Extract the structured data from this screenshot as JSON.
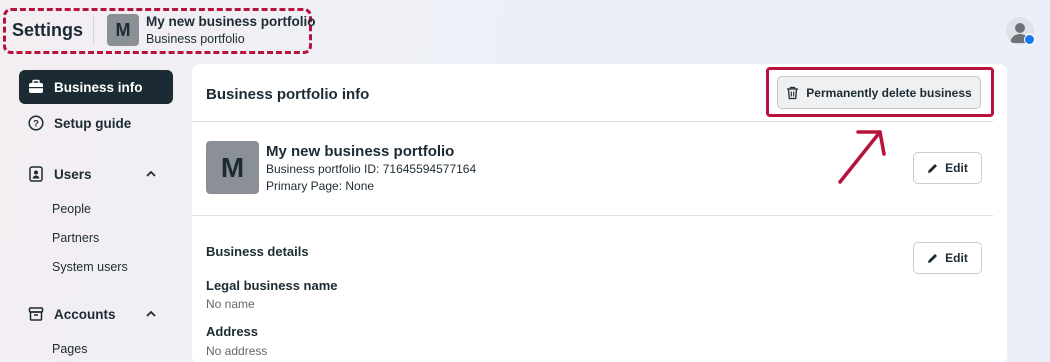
{
  "header": {
    "title": "Settings",
    "portfolio_initial": "M",
    "portfolio_name": "My new business portfolio",
    "portfolio_type": "Business portfolio"
  },
  "sidebar": {
    "items": [
      {
        "label": "Business info",
        "icon": "briefcase-icon",
        "active": true
      },
      {
        "label": "Setup guide",
        "icon": "help-circle-icon"
      },
      {
        "label": "Users",
        "icon": "user-badge-icon",
        "expanded": true,
        "children": [
          "People",
          "Partners",
          "System users"
        ]
      },
      {
        "label": "Accounts",
        "icon": "archive-icon",
        "expanded": true,
        "children": [
          "Pages"
        ]
      }
    ]
  },
  "main": {
    "title": "Business portfolio info",
    "delete_button": "Permanently delete business",
    "business": {
      "initial": "M",
      "name": "My new business portfolio",
      "id_line": "Business portfolio ID: 71645594577164",
      "primary_page_line": "Primary Page: None",
      "edit_label": "Edit"
    },
    "details": {
      "title": "Business details",
      "edit_label": "Edit",
      "fields": [
        {
          "label": "Legal business name",
          "value": "No name"
        },
        {
          "label": "Address",
          "value": "No address"
        }
      ]
    }
  },
  "colors": {
    "annotation": "#b5133c",
    "active_nav": "#1c2b33",
    "facebook_blue": "#1877f2"
  }
}
